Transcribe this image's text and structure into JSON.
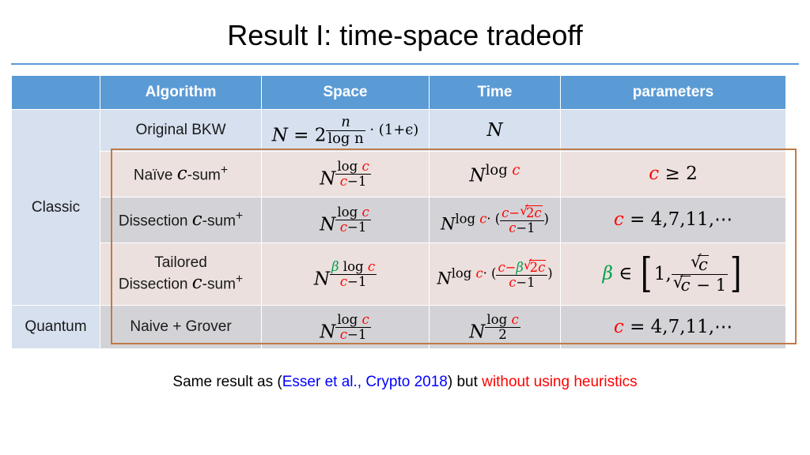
{
  "slide": {
    "title": "Result I: time-space tradeoff"
  },
  "table": {
    "headers": [
      "",
      "Algorithm",
      "Space",
      "Time",
      "parameters"
    ],
    "rows": [
      {
        "category": "Classic",
        "algorithm": "Original BKW",
        "space_plain": "N = 2^(n / log n · (1+ϵ))",
        "time_plain": "N",
        "parameters_plain": ""
      },
      {
        "category": "",
        "algorithm": "Naïve c-sum⁺",
        "space_plain": "N^(log c / (c−1))",
        "time_plain": "N^(log c)",
        "parameters_plain": "c ≥ 2"
      },
      {
        "category": "",
        "algorithm": "Dissection c-sum⁺",
        "space_plain": "N^(log c / (c−1))",
        "time_plain": "N^(log c · ((c−√2c)/(c−1)))",
        "parameters_plain": "c = 4,7,11, ⋯"
      },
      {
        "category": "",
        "algorithm_line1": "Tailored",
        "algorithm_line2": "Dissection c-sum⁺",
        "space_plain": "N^(β log c / (c−1))",
        "time_plain": "N^(log c · ((c−β√2c)/(c−1)))",
        "parameters_plain": "β ∈ [1, √c/(√c − 1)]"
      },
      {
        "category": "Quantum",
        "algorithm": "Naive + Grover",
        "space_plain": "N^(log c / (c−1))",
        "time_plain": "N^(log c / 2)",
        "parameters_plain": "c = 4,7,11, ⋯"
      }
    ],
    "symbols": {
      "N": "N",
      "n": "n",
      "c": "c",
      "beta": "β",
      "epsilon": "ϵ",
      "log": "log",
      "equals": "=",
      "two": "2",
      "one": "1",
      "geq": "≥",
      "in": "∈",
      "dots": "⋯",
      "cdot": "·",
      "minus": "−",
      "c_minus_1": "c−1",
      "one_plus_eps": "(1+ϵ)",
      "log_n": "log n",
      "list_4711": "4,7,11,",
      "c_sum_sup": "+",
      "naive_label": "Naïve",
      "dissection_label": "Dissection",
      "csum_label": "-sum"
    }
  },
  "caption": {
    "before": "Same result as (",
    "cite": "Esser et al., Crypto 2018",
    "middle": ") but ",
    "warn": "without using heuristics"
  },
  "colors": {
    "header_blue": "#5b9bd5",
    "row_blue": "#d6e0ef",
    "row_pink": "#ebe0dd",
    "row_gray": "#d3d3d7",
    "orange_border": "#c07a46",
    "red_accent": "#ff0000",
    "green_accent": "#00a14b",
    "link_blue": "#0000ff"
  }
}
